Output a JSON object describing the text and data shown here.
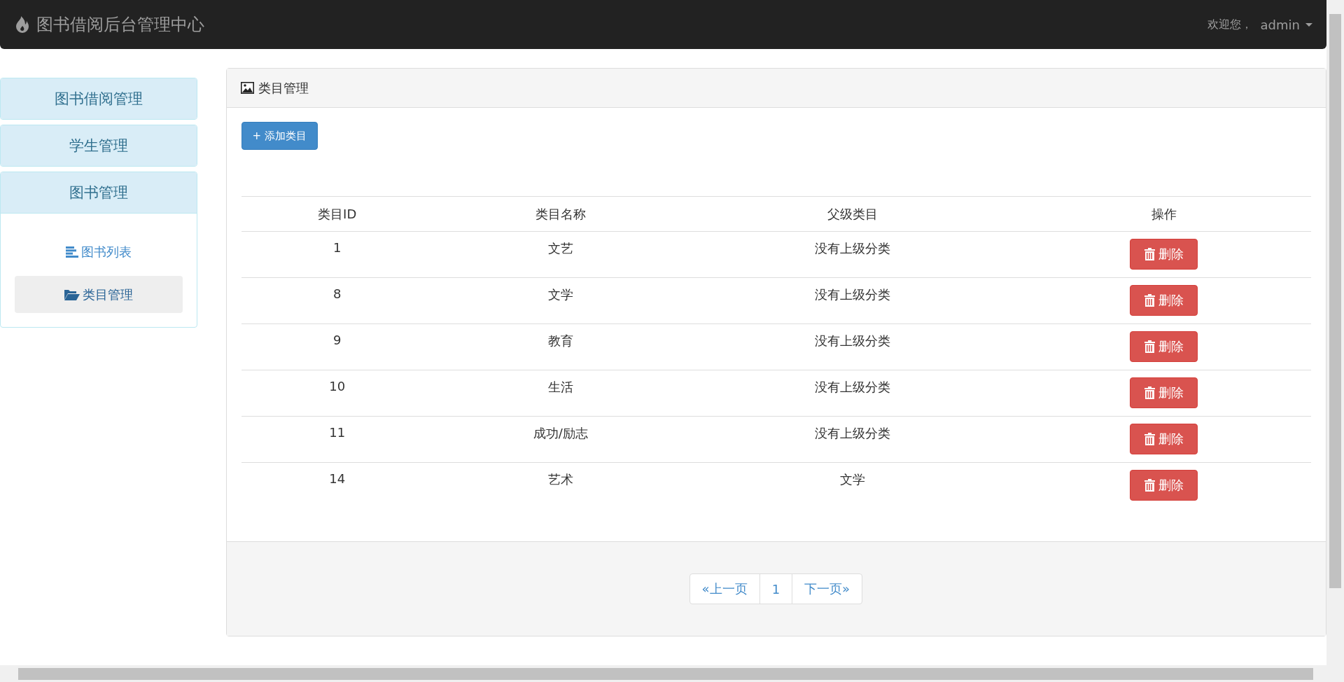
{
  "navbar": {
    "title": "图书借阅后台管理中心",
    "welcome": "欢迎您，",
    "user": "admin"
  },
  "sidebar": {
    "panels": [
      {
        "title": "图书借阅管理",
        "expanded": false
      },
      {
        "title": "学生管理",
        "expanded": false
      },
      {
        "title": "图书管理",
        "expanded": true,
        "items": [
          {
            "label": "图书列表",
            "kind": "list",
            "selected": false
          },
          {
            "label": "类目管理",
            "kind": "folder",
            "selected": true
          }
        ]
      }
    ]
  },
  "main": {
    "title": "类目管理",
    "add_button": "+ 添加类目",
    "table": {
      "columns": [
        "类目ID",
        "类目名称",
        "父级类目",
        "操作"
      ],
      "rows": [
        {
          "id": "1",
          "name": "文艺",
          "parent": "没有上级分类",
          "action": "删除"
        },
        {
          "id": "8",
          "name": "文学",
          "parent": "没有上级分类",
          "action": "删除"
        },
        {
          "id": "9",
          "name": "教育",
          "parent": "没有上级分类",
          "action": "删除"
        },
        {
          "id": "10",
          "name": "生活",
          "parent": "没有上级分类",
          "action": "删除"
        },
        {
          "id": "11",
          "name": "成功/励志",
          "parent": "没有上级分类",
          "action": "删除"
        },
        {
          "id": "14",
          "name": "艺术",
          "parent": "文学",
          "action": "删除"
        }
      ]
    },
    "pagination": [
      "«上一页",
      "1",
      "下一页»"
    ]
  }
}
